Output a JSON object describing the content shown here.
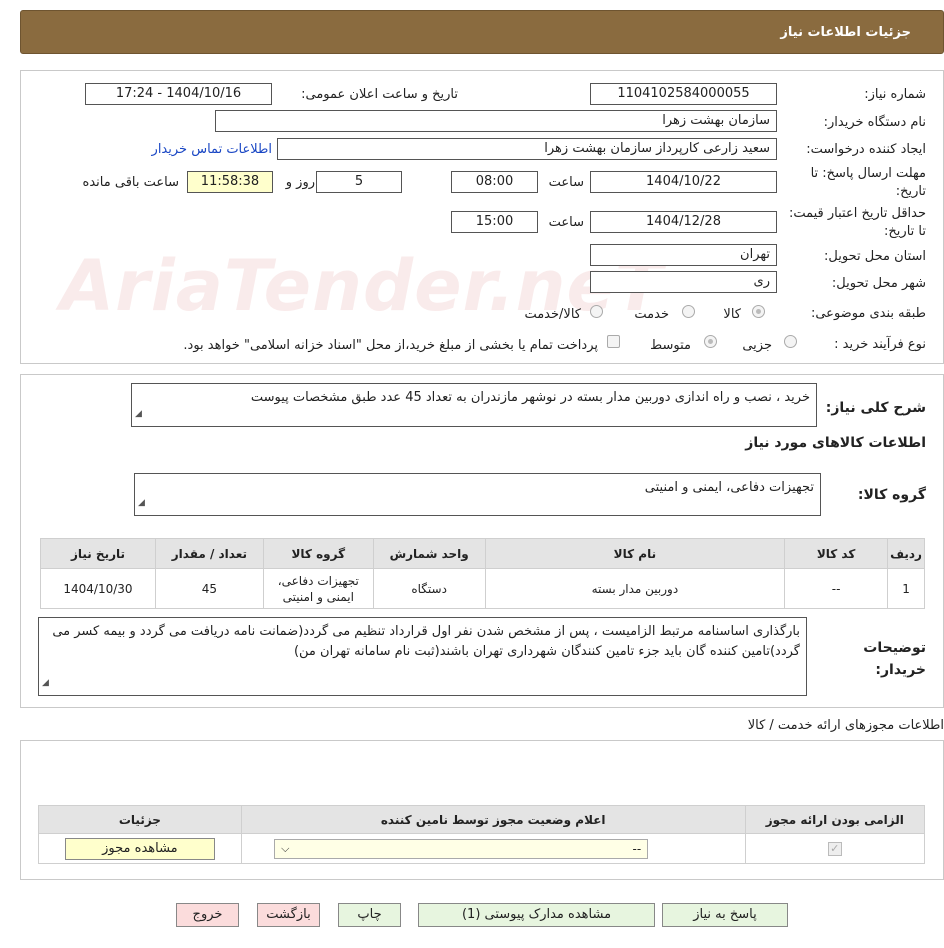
{
  "header": {
    "title": "جزئیات اطلاعات نیاز"
  },
  "watermark": "AriaTender.neT",
  "fields": {
    "need_number_label": "شماره نیاز:",
    "need_number": "1104102584000055",
    "announce_label": "تاریخ و ساعت اعلان عمومی:",
    "announce_value": "1404/10/16 - 17:24",
    "buyer_org_label": "نام دستگاه خریدار:",
    "buyer_org": "سازمان بهشت زهرا",
    "creator_label": "ایجاد کننده درخواست:",
    "creator": "سعید زارعی کارپرداز سازمان بهشت زهرا",
    "contact_link": "اطلاعات تماس خریدار",
    "deadline_label": "مهلت ارسال پاسخ: تا تاریخ:",
    "deadline_date": "1404/10/22",
    "time_label": "ساعت",
    "deadline_time": "08:00",
    "days": "5",
    "days_label": "روز و",
    "remaining_time": "11:58:38",
    "remaining_label": "ساعت باقی مانده",
    "validity_label": "حداقل تاریخ اعتبار قیمت: تا تاریخ:",
    "validity_date": "1404/12/28",
    "validity_time": "15:00",
    "province_label": "استان محل تحویل:",
    "province": "تهران",
    "city_label": "شهر محل تحویل:",
    "city": "ری",
    "category_label": "طبقه بندی موضوعی:",
    "category_options": [
      "کالا",
      "خدمت",
      "کالا/خدمت"
    ],
    "process_label": "نوع فرآیند خرید :",
    "process_options": [
      "جزیی",
      "متوسط"
    ],
    "payment_note": "پرداخت تمام یا بخشی از مبلغ خرید،از محل \"اسناد خزانه اسلامی\" خواهد بود."
  },
  "description": {
    "label": "شرح کلی نیاز:",
    "value": "خرید ، نصب و راه اندازی دوربین مدار بسته در نوشهر مازندران به تعداد 45 عدد طبق مشخصات پیوست"
  },
  "goods": {
    "section_title": "اطلاعات کالاهای مورد نیاز",
    "group_label": "گروه کالا:",
    "group_value": "تجهیزات دفاعی، ایمنی و امنیتی",
    "columns": [
      "ردیف",
      "کد کالا",
      "نام کالا",
      "واحد شمارش",
      "گروه کالا",
      "تعداد / مقدار",
      "تاریخ نیاز"
    ],
    "rows": [
      {
        "row": "1",
        "code": "--",
        "name": "دوربین مدار بسته",
        "unit": "دستگاه",
        "group": "تجهیزات دفاعی، ایمنی و امنیتی",
        "qty": "45",
        "date": "1404/10/30"
      }
    ]
  },
  "buyer_notes": {
    "label": "توضیحات خریدار:",
    "value": "بارگذاری اساسنامه مرتبط الزامیست ، پس از مشخص شدن نفر اول قرارداد تنظیم می گردد(ضمانت نامه دریافت می گردد و بیمه کسر می گردد)تامین کننده گان باید جزء تامین کنندگان شهرداری تهران باشند(ثبت نام سامانه تهران من)"
  },
  "licenses": {
    "title": "اطلاعات مجوزهای ارائه خدمت / کالا",
    "columns": [
      "الزامی بودن ارائه مجوز",
      "اعلام وضعیت مجوز توسط نامین کننده",
      "جزئیات"
    ],
    "select_value": "--",
    "view_button": "مشاهده مجوز"
  },
  "buttons": {
    "reply": "پاسخ به نیاز",
    "attachments": "مشاهده مدارک پیوستی (1)",
    "print": "چاپ",
    "back": "بازگشت",
    "exit": "خروج"
  },
  "colors": {
    "header": "#8a6b3f",
    "button_green": "#e7f5df",
    "button_pink": "#fbdcdc",
    "yellow_box": "#ffffcc"
  }
}
